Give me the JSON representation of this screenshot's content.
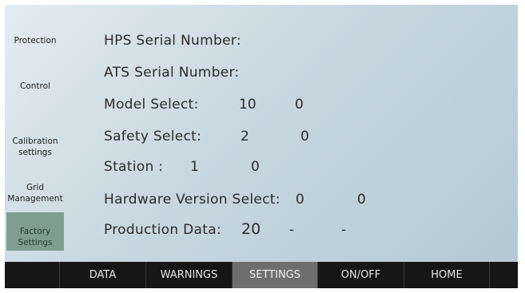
{
  "sidebar": {
    "items": [
      {
        "label": "Protection"
      },
      {
        "label": "Control"
      },
      {
        "label": "Calibration\nsettings"
      },
      {
        "label": "Grid\nManagement"
      },
      {
        "label": "Factory\nSettings",
        "active": true
      }
    ]
  },
  "fields": {
    "hps_serial": {
      "label": "HPS Serial Number:"
    },
    "ats_serial": {
      "label": "ATS Serial Number:"
    },
    "model_select": {
      "label": "Model Select:",
      "value1": "10",
      "value2": "0"
    },
    "safety_select": {
      "label": "Safety Select:",
      "value1": "2",
      "value2": "0"
    },
    "station": {
      "label": "Station :",
      "value1": "1",
      "value2": "0"
    },
    "hardware_version": {
      "label": "Hardware Version Select:",
      "value1": "0",
      "value2": "0"
    },
    "production_data": {
      "label": "Production Data:",
      "value1": "20",
      "sep1": "-",
      "sep2": "-"
    }
  },
  "bottom_nav": {
    "tabs": [
      {
        "label": ""
      },
      {
        "label": "DATA"
      },
      {
        "label": "WARNINGS"
      },
      {
        "label": "SETTINGS",
        "active": true
      },
      {
        "label": "ON/OFF"
      },
      {
        "label": "HOME"
      },
      {
        "label": ""
      }
    ]
  },
  "colors": {
    "active_sidebar": "#7f9e91",
    "nav_background": "#161616",
    "active_tab": "#6e6e6e"
  }
}
